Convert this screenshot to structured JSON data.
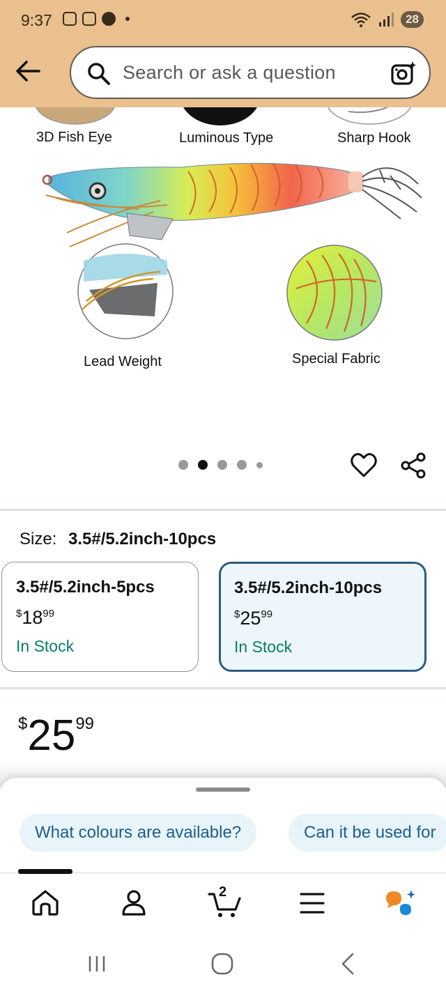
{
  "status_bar": {
    "time": "9:37",
    "battery": "28"
  },
  "search": {
    "placeholder": "Search or ask a question"
  },
  "product_image": {
    "features": [
      "3D Fish Eye",
      "Luminous Type",
      "Sharp Hook",
      "Lead Weight",
      "Special Fabric"
    ]
  },
  "carousel": {
    "count": 5,
    "active_index": 1
  },
  "size": {
    "label": "Size:",
    "selected": "3.5#/5.2inch-10pcs",
    "options": [
      {
        "name": "3.5#/5.2inch-5pcs",
        "currency": "$",
        "whole": "18",
        "fraction": "99",
        "stock": "In Stock"
      },
      {
        "name": "3.5#/5.2inch-10pcs",
        "currency": "$",
        "whole": "25",
        "fraction": "99",
        "stock": "In Stock"
      }
    ]
  },
  "price": {
    "currency": "$",
    "whole": "25",
    "fraction": "99"
  },
  "suggestions": [
    "What colours are available?",
    "Can it be used for"
  ],
  "nav": {
    "cart_count": "2"
  },
  "colors": {
    "accent": "#2d5a84",
    "stock_green": "#067d62",
    "topbar": "#e9c08e"
  }
}
